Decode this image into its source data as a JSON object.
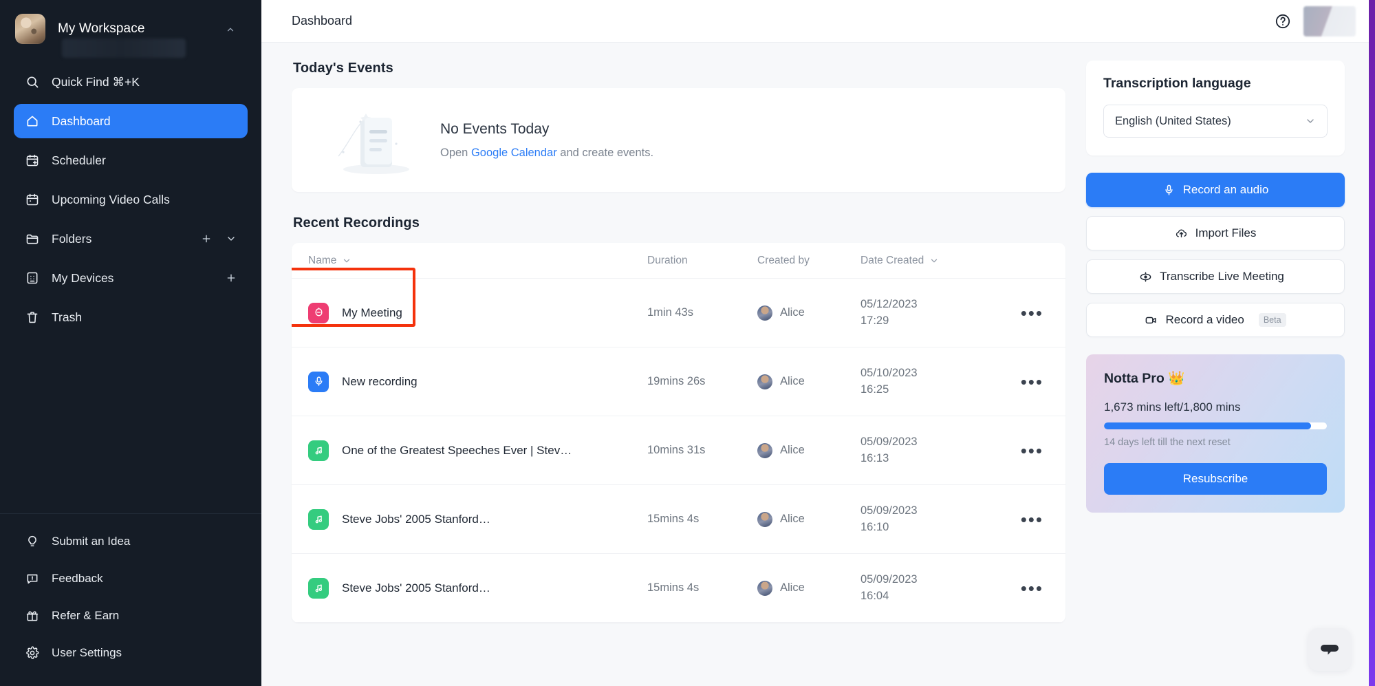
{
  "sidebar": {
    "workspace": {
      "name": "My Workspace",
      "avatar_icon": "cat-avatar",
      "caret_icon": "chevron-up-icon"
    },
    "items": [
      {
        "label": "Quick Find ⌘+K",
        "icon": "search-icon",
        "active": false
      },
      {
        "label": "Dashboard",
        "icon": "home-icon",
        "active": true
      },
      {
        "label": "Scheduler",
        "icon": "calendar-plus-icon",
        "active": false
      },
      {
        "label": "Upcoming Video Calls",
        "icon": "calendar-icon",
        "active": false
      },
      {
        "label": "Folders",
        "icon": "folder-icon",
        "active": false,
        "actions": [
          "plus-icon",
          "chevron-down-icon"
        ]
      },
      {
        "label": "My Devices",
        "icon": "device-icon",
        "active": false,
        "actions": [
          "plus-icon"
        ]
      },
      {
        "label": "Trash",
        "icon": "trash-icon",
        "active": false
      }
    ],
    "bottom_items": [
      {
        "label": "Submit an Idea",
        "icon": "lightbulb-icon"
      },
      {
        "label": "Feedback",
        "icon": "feedback-icon"
      },
      {
        "label": "Refer & Earn",
        "icon": "gift-icon"
      },
      {
        "label": "User Settings",
        "icon": "gear-icon"
      }
    ]
  },
  "topbar": {
    "title": "Dashboard",
    "help_icon": "help-circle-icon",
    "avatar_icon": "user-avatar"
  },
  "events": {
    "section_title": "Today's Events",
    "heading": "No Events Today",
    "sub_prefix": "Open ",
    "link": "Google Calendar",
    "sub_suffix": " and create events."
  },
  "recordings": {
    "section_title": "Recent Recordings",
    "columns": {
      "name": "Name",
      "duration": "Duration",
      "created_by": "Created by",
      "date_created": "Date Created"
    },
    "rows": [
      {
        "name": "My Meeting",
        "icon": "meeting-icon",
        "icon_color": "#ee3d72",
        "duration": "1min 43s",
        "created_by": "Alice",
        "date": "05/12/2023",
        "time": "17:29",
        "highlighted": true
      },
      {
        "name": "New recording",
        "icon": "mic-icon",
        "icon_color": "#2b7cf6",
        "duration": "19mins 26s",
        "created_by": "Alice",
        "date": "05/10/2023",
        "time": "16:25",
        "highlighted": false
      },
      {
        "name": "One of the Greatest Speeches Ever | Stev…",
        "icon": "audio-file-icon",
        "icon_color": "#34cc7f",
        "duration": "10mins 31s",
        "created_by": "Alice",
        "date": "05/09/2023",
        "time": "16:13",
        "highlighted": false
      },
      {
        "name": "Steve Jobs' 2005 Stanford…",
        "icon": "audio-file-icon",
        "icon_color": "#34cc7f",
        "duration": "15mins 4s",
        "created_by": "Alice",
        "date": "05/09/2023",
        "time": "16:10",
        "highlighted": false
      },
      {
        "name": "Steve Jobs' 2005 Stanford…",
        "icon": "audio-file-icon",
        "icon_color": "#34cc7f",
        "duration": "15mins 4s",
        "created_by": "Alice",
        "date": "05/09/2023",
        "time": "16:04",
        "highlighted": false
      }
    ],
    "row_menu_icon": "more-horizontal-icon"
  },
  "transcription": {
    "card_title": "Transcription language",
    "selected_language": "English (United States)",
    "chevron_icon": "chevron-down-icon"
  },
  "actions": {
    "record_audio": "Record an audio",
    "import_files": "Import Files",
    "transcribe_live": "Transcribe Live Meeting",
    "record_video": "Record a video",
    "record_video_badge": "Beta",
    "icons": {
      "record_audio": "mic-icon",
      "import_files": "cloud-upload-icon",
      "transcribe_live": "live-meeting-icon",
      "record_video": "video-camera-icon"
    }
  },
  "pro": {
    "title": "Notta Pro",
    "title_emoji": "👑",
    "minutes": "1,673 mins left/1,800 mins",
    "progress_percent": 93,
    "reset_note": "14 days left till the next reset",
    "cta": "Resubscribe"
  },
  "chat": {
    "icon": "chat-bubble-icon"
  },
  "colors": {
    "accent": "#2b7cf6",
    "sidebar_bg": "#151c26",
    "highlight_outline": "#f4320c",
    "page_bg": "#f7f8fa",
    "icon_pink": "#ee3d72",
    "icon_green": "#34cc7f",
    "edge_strip": "#7c3aed"
  }
}
